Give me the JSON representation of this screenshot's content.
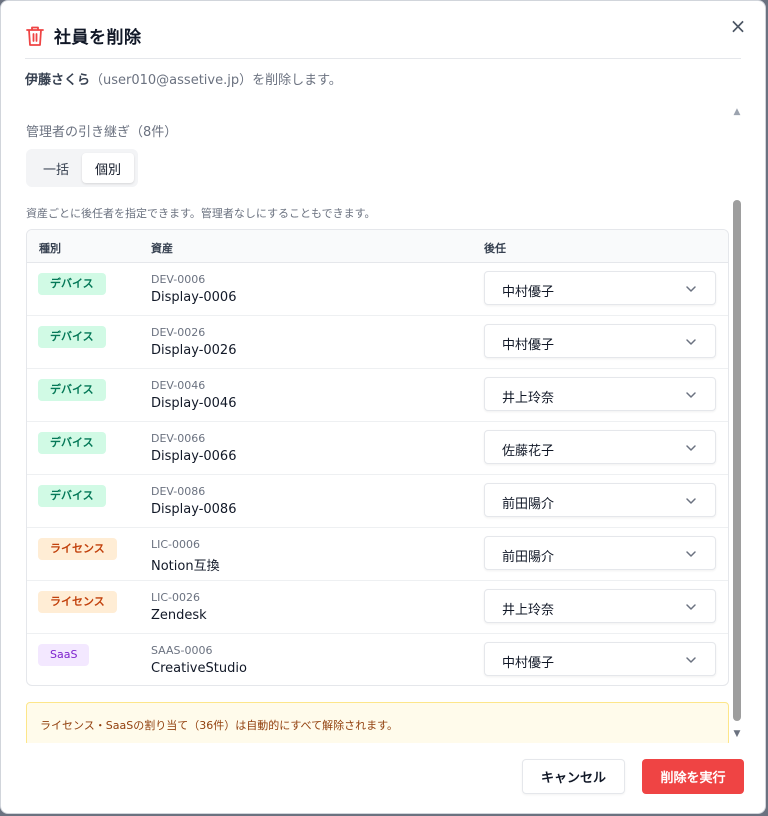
{
  "dialog": {
    "title": "社員を削除",
    "close_icon": "×",
    "user_name": "伊藤さくら",
    "user_email_text": "（user010@assetive.jp）を削除します。"
  },
  "transfer": {
    "section_title": "管理者の引き継ぎ（8件）",
    "mode_bulk": "一括",
    "mode_individual": "個別",
    "selected_mode": "個別",
    "hint": "資産ごとに後任者を指定できます。管理者なしにすることもできます。",
    "columns": {
      "type": "種別",
      "asset": "資産",
      "successor": "後任"
    },
    "rows": [
      {
        "type": "デバイス",
        "kind": "device",
        "code": "DEV-0006",
        "name": "Display-0006",
        "successor": "中村優子"
      },
      {
        "type": "デバイス",
        "kind": "device",
        "code": "DEV-0026",
        "name": "Display-0026",
        "successor": "中村優子"
      },
      {
        "type": "デバイス",
        "kind": "device",
        "code": "DEV-0046",
        "name": "Display-0046",
        "successor": "井上玲奈"
      },
      {
        "type": "デバイス",
        "kind": "device",
        "code": "DEV-0066",
        "name": "Display-0066",
        "successor": "佐藤花子"
      },
      {
        "type": "デバイス",
        "kind": "device",
        "code": "DEV-0086",
        "name": "Display-0086",
        "successor": "前田陽介"
      },
      {
        "type": "ライセンス",
        "kind": "license",
        "code": "LIC-0006",
        "name": "Notion互換",
        "successor": "前田陽介"
      },
      {
        "type": "ライセンス",
        "kind": "license",
        "code": "LIC-0026",
        "name": "Zendesk",
        "successor": "井上玲奈"
      },
      {
        "type": "SaaS",
        "kind": "saas",
        "code": "SAAS-0006",
        "name": "CreativeStudio",
        "successor": "中村優子"
      }
    ],
    "notice": "ライセンス・SaaSの割り当て（36件）は自動的にすべて解除されます。"
  },
  "footer": {
    "cancel_label": "キャンセル",
    "delete_label": "削除を実行"
  },
  "colors": {
    "danger": "#ef4444",
    "device_badge_bg": "#d1fae5",
    "license_badge_bg": "#ffedd5",
    "saas_badge_bg": "#f3e8ff",
    "notice_bg": "#fffbeb"
  },
  "icons": {
    "title": "trash-icon",
    "close": "close-icon",
    "select": "chevron-down-icon"
  }
}
